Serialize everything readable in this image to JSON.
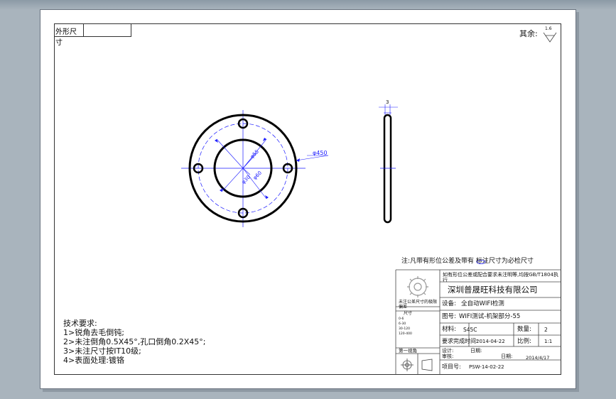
{
  "corner_label": "外形尺寸",
  "others_label": "其余:",
  "roughness_value": "1.6",
  "dims": {
    "pitch": "φ55",
    "bore": "φ30",
    "outer_ring": "φ60",
    "outer": "φ450",
    "thickness": "3"
  },
  "tech_requirements": {
    "title": "技术要求:",
    "items": [
      "1>锐角去毛倒钝;",
      "2>未注倒角0.5X45°,孔口倒角0.2X45°;",
      "3>未注尺寸按IT10级;",
      "4>表面处理:镀铬"
    ]
  },
  "title_block": {
    "note": "注:凡带有形位公差及带有     标注尺寸为必检尺寸",
    "tolerance_text": "如有形位公差或配合要求未注明等,均按GB/T1804执行",
    "company": "深圳普晟旺科技有限公司",
    "device_label": "设备:",
    "device_value": "全自动WIFI检测",
    "drawing_label": "图号:",
    "drawing_value": "WIFI测试-机架部分-55",
    "material_label": "材料:",
    "material_value": "S45C",
    "qty_label": "数量:",
    "qty_value": "2",
    "due_label": "要求完成时间:",
    "due_value": "2014-04-22",
    "scale_label": "比例:",
    "scale_value": "1:1",
    "left_top": "未注公差尺寸的极限偏差",
    "left_size_header": "尺寸",
    "left_grid": [
      "0-6",
      "6-30",
      "30-120",
      "120-400"
    ],
    "left_bottom": "第一视角",
    "designer_label": "设计:",
    "date_label": "日期:",
    "checker_label": "审核:",
    "check_date_label": "日期:",
    "check_date_value": "2014/4/17",
    "project_label": "项目号:",
    "project_value": "PSW-14-02-22"
  }
}
